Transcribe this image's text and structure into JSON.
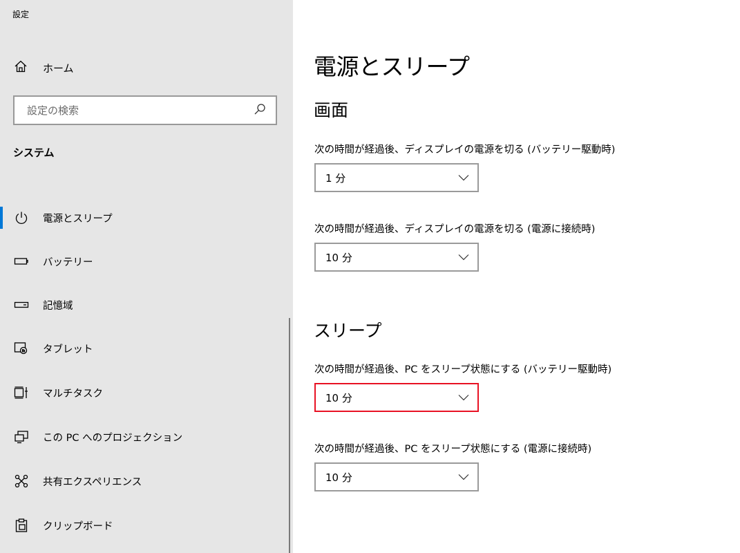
{
  "app_title": "設定",
  "home_label": "ホーム",
  "search": {
    "placeholder": "設定の検索"
  },
  "sidebar": {
    "section": "システム",
    "items": [
      {
        "label": "電源とスリープ",
        "icon": "power-icon",
        "active": true
      },
      {
        "label": "バッテリー",
        "icon": "battery-icon"
      },
      {
        "label": "記憶域",
        "icon": "storage-icon"
      },
      {
        "label": "タブレット",
        "icon": "tablet-icon"
      },
      {
        "label": "マルチタスク",
        "icon": "multitask-icon"
      },
      {
        "label": "この PC へのプロジェクション",
        "icon": "projection-icon"
      },
      {
        "label": "共有エクスペリエンス",
        "icon": "shared-experiences-icon"
      },
      {
        "label": "クリップボード",
        "icon": "clipboard-icon"
      }
    ]
  },
  "main": {
    "title": "電源とスリープ",
    "screen": {
      "heading": "画面",
      "battery_label": "次の時間が経過後、ディスプレイの電源を切る (バッテリー駆動時)",
      "battery_value": "1 分",
      "plugged_label": "次の時間が経過後、ディスプレイの電源を切る (電源に接続時)",
      "plugged_value": "10 分"
    },
    "sleep": {
      "heading": "スリープ",
      "battery_label": "次の時間が経過後、PC をスリープ状態にする (バッテリー駆動時)",
      "battery_value": "10 分",
      "plugged_label": "次の時間が経過後、PC をスリープ状態にする (電源に接続時)",
      "plugged_value": "10 分"
    }
  },
  "colors": {
    "accent": "#0078d7",
    "focus_border": "#e81123",
    "sidebar_bg": "#e6e6e6"
  }
}
